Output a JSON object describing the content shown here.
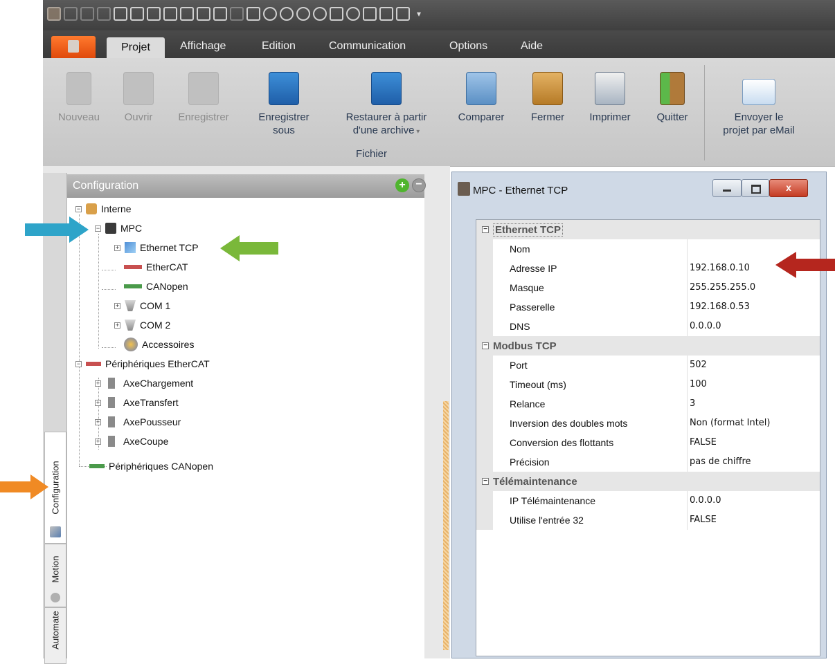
{
  "menu": {
    "tabs": [
      "Projet",
      "Affichage",
      "Edition",
      "Communication",
      "Options",
      "Aide"
    ]
  },
  "ribbon": {
    "buttons": {
      "nouveau": "Nouveau",
      "ouvrir": "Ouvrir",
      "enregistrer": "Enregistrer",
      "enregistrer_sous_1": "Enregistrer",
      "enregistrer_sous_2": "sous",
      "restaurer_1": "Restaurer à partir",
      "restaurer_2": "d'une archive",
      "comparer": "Comparer",
      "fermer": "Fermer",
      "imprimer": "Imprimer",
      "quitter": "Quitter",
      "envoyer_1": "Envoyer le",
      "envoyer_2": "projet par eMail"
    },
    "group_label": "Fichier"
  },
  "side_tabs": [
    "Configuration",
    "Motion",
    "Automate"
  ],
  "configuration": {
    "title": "Configuration",
    "tree": {
      "interne": "Interne",
      "mpc": "MPC",
      "ethernet": "Ethernet TCP",
      "ethercat": "EtherCAT",
      "canopen": "CANopen",
      "com1": "COM 1",
      "com2": "COM 2",
      "accessoires": "Accessoires",
      "periph_ethercat": "Périphériques EtherCAT",
      "axe1": "AxeChargement",
      "axe2": "AxeTransfert",
      "axe3": "AxePousseur",
      "axe4": "AxeCoupe",
      "periph_canopen": "Périphériques CANopen"
    }
  },
  "window": {
    "title": "MPC - Ethernet TCP",
    "close_label": "x",
    "categories": {
      "ethernet": "Ethernet TCP",
      "modbus": "Modbus TCP",
      "tele": "Télémaintenance"
    },
    "props": {
      "nom": {
        "name": "Nom",
        "value": ""
      },
      "ip": {
        "name": "Adresse IP",
        "value": "192.168.0.10"
      },
      "masque": {
        "name": "Masque",
        "value": "255.255.255.0"
      },
      "passerelle": {
        "name": "Passerelle",
        "value": "192.168.0.53"
      },
      "dns": {
        "name": "DNS",
        "value": "0.0.0.0"
      },
      "port": {
        "name": "Port",
        "value": "502"
      },
      "timeout": {
        "name": "Timeout (ms)",
        "value": "100"
      },
      "relance": {
        "name": "Relance",
        "value": "3"
      },
      "inversion": {
        "name": "Inversion des doubles mots",
        "value": "Non (format Intel)"
      },
      "conversion": {
        "name": "Conversion des flottants",
        "value": "FALSE"
      },
      "precision": {
        "name": "Précision",
        "value": "pas de chiffre"
      },
      "ip_tele": {
        "name": "IP Télémaintenance",
        "value": "0.0.0.0"
      },
      "entree32": {
        "name": "Utilise l'entrée 32",
        "value": "FALSE"
      }
    }
  },
  "colors": {
    "arrow_blue": "#2ea4c9",
    "arrow_green": "#7ab83a",
    "arrow_red": "#b5261e",
    "arrow_orange": "#f08a24",
    "app_orange": "#e85a17"
  }
}
